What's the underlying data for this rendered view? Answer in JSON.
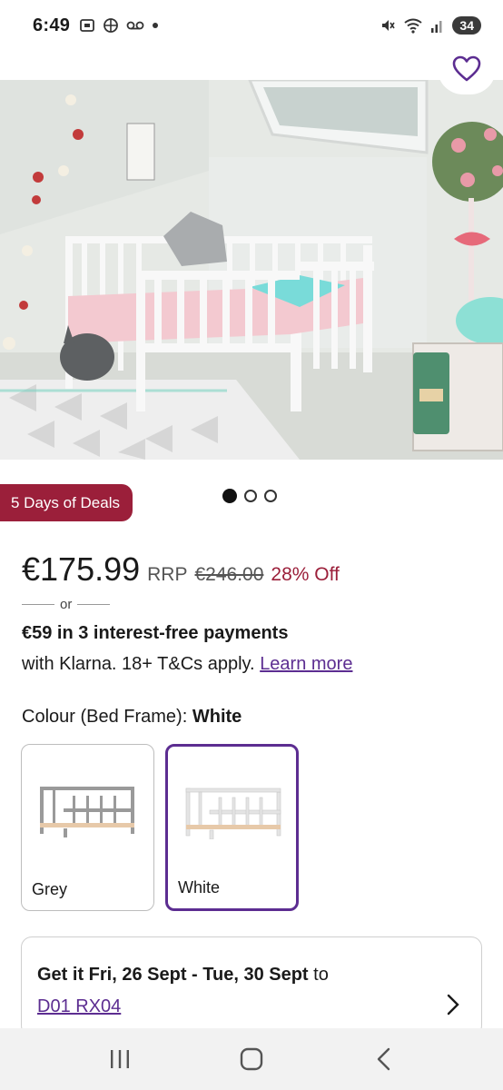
{
  "status_bar": {
    "time": "6:49",
    "battery": "34"
  },
  "product": {
    "deal_badge": "5 Days of Deals",
    "carousel": {
      "count": 3,
      "active": 0
    },
    "price": "€175.99",
    "rrp_label": "RRP",
    "rrp_value": "€246.00",
    "discount": "28% Off",
    "or_text": "or",
    "klarna_bold": "€59 in 3 interest-free payments",
    "klarna_sub": "with Klarna. 18+ T&Cs apply.",
    "learn_more": "Learn more"
  },
  "colour": {
    "label": "Colour (Bed Frame):",
    "selected": "White",
    "options": [
      {
        "label": "Grey"
      },
      {
        "label": "White"
      }
    ]
  },
  "delivery": {
    "prefix": "Get it Fri, 26 Sept - Tue, 30 Sept",
    "suffix": "to",
    "postcode": "D01 RX04"
  },
  "colors": {
    "brand_purple": "#5c2d91",
    "deal_red": "#9b1f3a"
  },
  "icons": {
    "wishlist": "heart-outline-icon",
    "nav_recents": "recents-icon",
    "nav_home": "home-icon",
    "nav_back": "back-icon",
    "delivery_chevron": "chevron-right-icon"
  }
}
